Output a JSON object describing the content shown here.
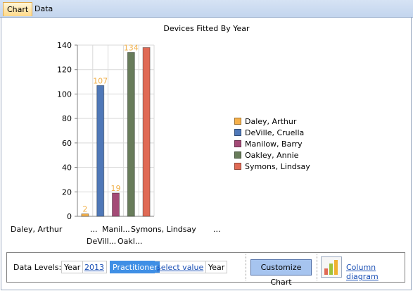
{
  "tabs": [
    {
      "label": "Chart"
    },
    {
      "label": "Data"
    }
  ],
  "chart_data": {
    "type": "bar",
    "title": "Devices Fitted By Year",
    "xlabel": "",
    "ylabel": "",
    "ylim": [
      0,
      140
    ],
    "yticks": [
      0,
      20,
      40,
      60,
      80,
      100,
      120,
      140
    ],
    "grid": true,
    "legend_position": "right",
    "series": [
      {
        "name": "Daley, Arthur",
        "value": 2,
        "label": "2",
        "color": "#f5b04a"
      },
      {
        "name": "DeVille, Cruella",
        "value": 107,
        "label": "107",
        "color": "#4f78b8"
      },
      {
        "name": "Manilow, Barry",
        "value": 19,
        "label": "19",
        "color": "#a44a76"
      },
      {
        "name": "Oakley, Annie",
        "value": 134,
        "label": "134",
        "color": "#687c5a"
      },
      {
        "name": "Symons, Lindsay",
        "value": 138,
        "label": "",
        "color": "#e06a55"
      }
    ],
    "category_labels": {
      "row1": [
        "Daley, Arthur",
        "...",
        "Manil...",
        "Symons, Lindsay",
        "..."
      ],
      "row2": [
        "DeVill...",
        "Oakl..."
      ]
    },
    "data_label_color": "#f0b04a"
  },
  "toolbar": {
    "data_levels_label": "Data Levels:",
    "year_chip": "Year",
    "year_value": "2013",
    "practitioner_chip": "Practitioner",
    "practitioner_value": "select value",
    "year_chip_2": "Year",
    "customize_label": "Customize Chart",
    "diagram_label": "Column diagram"
  }
}
